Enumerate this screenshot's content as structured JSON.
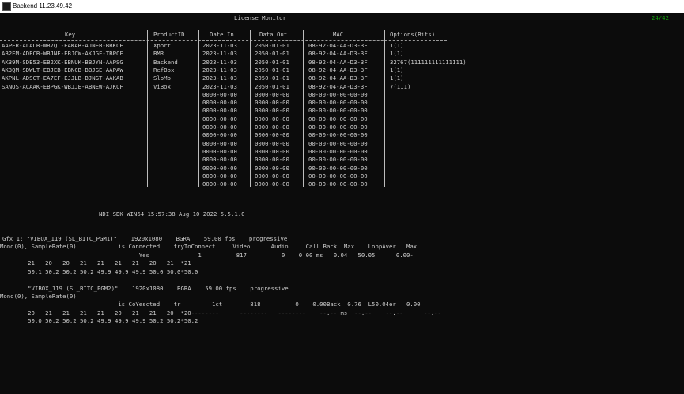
{
  "window": {
    "title": "Backend 11.23.49.42",
    "counter": "24/42"
  },
  "monitor": {
    "title": "License Monitor",
    "headers": {
      "key": "Key",
      "product": "ProductID",
      "date_in": "Date In",
      "date_out": "Data Out",
      "mac": "MAC",
      "options": "Options(Bits)"
    },
    "rows": [
      {
        "key": "AAPER-ALALB-WB7QT-EAKAB-AJNEB-BBKCE",
        "product": "Xport",
        "date_in": "2023-11-03",
        "date_out": "2050-01-01",
        "mac": "08-92-04-AA-D3-3F",
        "options": "1(1)"
      },
      {
        "key": "AB2EM-ADECB-WBJNE-EBJCW-AKJGF-TBPCF",
        "product": "BMR",
        "date_in": "2023-11-03",
        "date_out": "2050-01-01",
        "mac": "08-92-04-AA-D3-3F",
        "options": "1(1)"
      },
      {
        "key": "AK39M-SDE53-EB2XK-EBNUK-BBJYN-AAPSG",
        "product": "Backend",
        "date_in": "2023-11-03",
        "date_out": "2050-01-01",
        "mac": "08-92-04-AA-D3-3F",
        "options": "32767(111111111111111)"
      },
      {
        "key": "AK3QM-SDWLT-EBJEB-EBNCB-BBJGE-AAPAW",
        "product": "RefBox",
        "date_in": "2023-11-03",
        "date_out": "2050-01-01",
        "mac": "08-92-04-AA-D3-3F",
        "options": "1(1)"
      },
      {
        "key": "AKPNL-ADSCT-EA7EF-EJJLB-BJNGT-AAKAB",
        "product": "SloMo",
        "date_in": "2023-11-03",
        "date_out": "2050-01-01",
        "mac": "08-92-04-AA-D3-3F",
        "options": "1(1)"
      },
      {
        "key": "SANQS-ACAAK-EBPGK-WBJJE-ABNEW-AJKCF",
        "product": "ViBox",
        "date_in": "2023-11-03",
        "date_out": "2050-01-01",
        "mac": "08-92-04-AA-D3-3F",
        "options": "7(111)"
      },
      {
        "key": "",
        "product": "",
        "date_in": "0000-00-00",
        "date_out": "0000-00-00",
        "mac": "00-00-00-00-00-00",
        "options": ""
      },
      {
        "key": "",
        "product": "",
        "date_in": "0000-00-00",
        "date_out": "0000-00-00",
        "mac": "00-00-00-00-00-00",
        "options": ""
      },
      {
        "key": "",
        "product": "",
        "date_in": "0000-00-00",
        "date_out": "0000-00-00",
        "mac": "00-00-00-00-00-00",
        "options": ""
      },
      {
        "key": "",
        "product": "",
        "date_in": "0000-00-00",
        "date_out": "0000-00-00",
        "mac": "00-00-00-00-00-00",
        "options": ""
      },
      {
        "key": "",
        "product": "",
        "date_in": "0000-00-00",
        "date_out": "0000-00-00",
        "mac": "00-00-00-00-00-00",
        "options": ""
      },
      {
        "key": "",
        "product": "",
        "date_in": "0000-00-00",
        "date_out": "0000-00-00",
        "mac": "00-00-00-00-00-00",
        "options": ""
      },
      {
        "key": "",
        "product": "",
        "date_in": "0000-00-00",
        "date_out": "0000-00-00",
        "mac": "00-00-00-00-00-00",
        "options": ""
      },
      {
        "key": "",
        "product": "",
        "date_in": "0000-00-00",
        "date_out": "0000-00-00",
        "mac": "00-00-00-00-00-00",
        "options": ""
      },
      {
        "key": "",
        "product": "",
        "date_in": "0000-00-00",
        "date_out": "0000-00-00",
        "mac": "00-00-00-00-00-00",
        "options": ""
      },
      {
        "key": "",
        "product": "",
        "date_in": "0000-00-00",
        "date_out": "0000-00-00",
        "mac": "00-00-00-00-00-00",
        "options": ""
      },
      {
        "key": "",
        "product": "",
        "date_in": "0000-00-00",
        "date_out": "0000-00-00",
        "mac": "00-00-00-00-00-00",
        "options": ""
      },
      {
        "key": "",
        "product": "",
        "date_in": "0000-00-00",
        "date_out": "0000-00-00",
        "mac": "00-00-00-00-00-00",
        "options": ""
      }
    ]
  },
  "ndi": {
    "sdk": "NDI SDK WIN64 15:57:38 Aug 10 2022 5.5.1.0",
    "gfx1": {
      "line1": "Gfx 1: \"VIBOX_119 (SL_BITC_PGM1)\"    1920x1080    BGRA    59.00 fps    progressive",
      "line2": "Mono(0), SampleRate(0)            is Connected    tryToConnect     Video      Audio     Call Back  Max    LoopAver   Max",
      "line3": "                                        Yes              1          817          0    0.00 ms   0.04   50.05      0.00-",
      "line4": "        21   20   20   21   21   21   21   20   21  *21",
      "line5": "        50.1 50.2 50.2 50.2 49.9 49.9 49.9 50.0 50.0*50.0"
    },
    "gfx2": {
      "line1": "        \"VIBOX_119 (SL_BITC_PGM2)\"    1920x1080    BGRA    59.00 fps    progressive",
      "line2": "Mono(0), SampleRate(0)",
      "line3": "                                  is CoYescted    tr         1ct        818          0    0.00Back  0.76  L50.04er   0.00",
      "line4": "        20   21   21   21   21   20   21   21   20  *20--------      --------   --------    --.-- ms  --.--    --.--      --.--",
      "line5": "        50.0 50.2 50.2 50.2 49.9 49.9 49.9 50.2 50.2*50.2"
    }
  }
}
